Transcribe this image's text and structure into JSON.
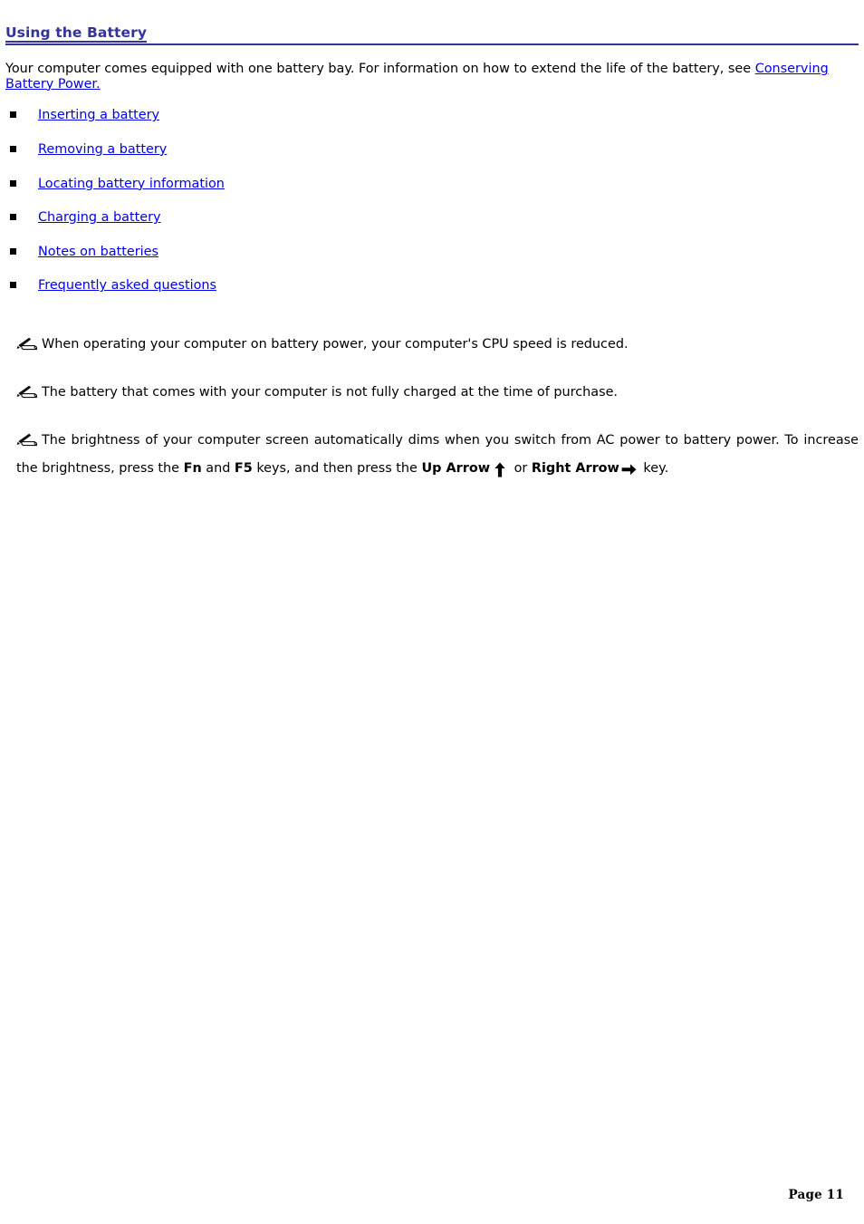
{
  "document": {
    "title": "Using the Battery",
    "heading_color": "#333399",
    "link_color": "#0000ee",
    "rule_color": "#333399"
  },
  "intro": {
    "text_before_link": "Your computer comes equipped with one battery bay. For information on how to extend the life of the battery, see ",
    "link_label": "Conserving Battery Power."
  },
  "link_list": {
    "bullet_glyph": "square",
    "items": [
      {
        "label": "Inserting a battery"
      },
      {
        "label": "Removing a battery"
      },
      {
        "label": "Locating battery information"
      },
      {
        "label": "Charging a battery"
      },
      {
        "label": "Notes on batteries"
      },
      {
        "label": "Frequently asked questions"
      }
    ]
  },
  "notes": {
    "icon_name": "writing-hand-note-icon",
    "items": [
      {
        "text": "When operating your computer on battery power, your computer's CPU speed is reduced."
      },
      {
        "text": "The battery that comes with your computer is not fully charged at the time of purchase."
      }
    ],
    "note3": {
      "segment_1": "The brightness of your computer screen automatically dims when you switch from AC power to battery power. To increase the brightness, press the ",
      "key_fn": "Fn",
      "segment_2": " and ",
      "key_f5": "F5",
      "segment_3": " keys, and then press the ",
      "key_up": "Up Arrow",
      "up_arrow_icon": "up-arrow-icon",
      "segment_4": " or ",
      "key_right": "Right Arrow",
      "right_arrow_icon": "right-arrow-icon",
      "segment_5": " key."
    }
  },
  "footer": {
    "page_label": "Page 11"
  }
}
